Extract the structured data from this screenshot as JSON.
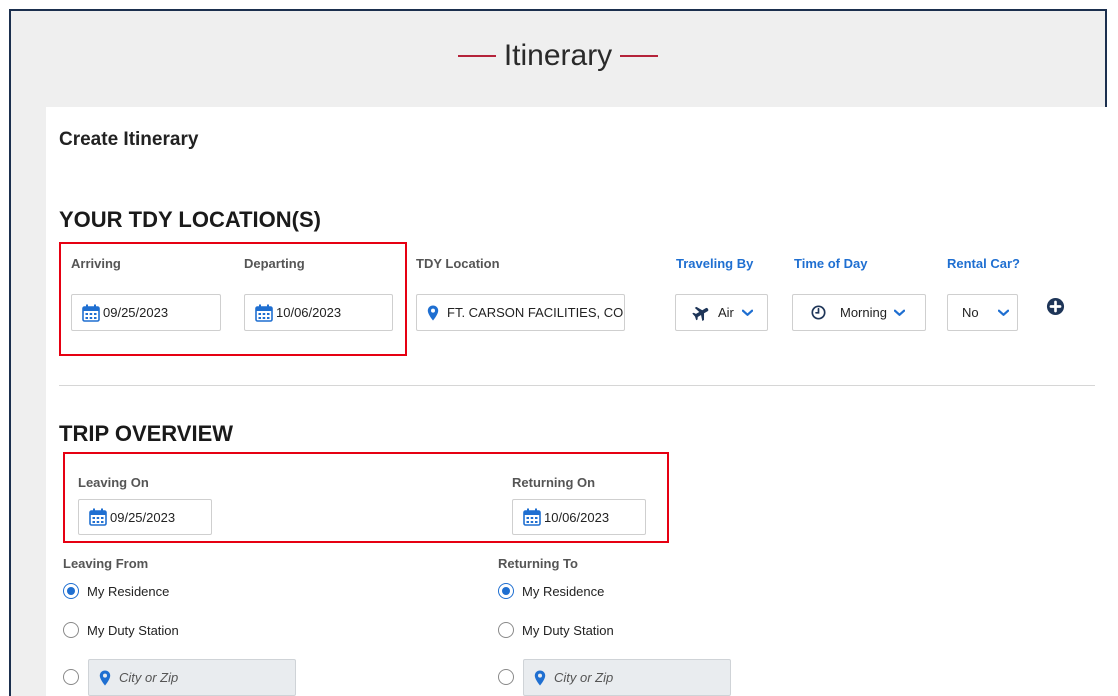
{
  "page": {
    "title": "Itinerary"
  },
  "card": {
    "title": "Create Itinerary"
  },
  "tdy": {
    "section_title": "YOUR TDY LOCATION(S)",
    "arriving_label": "Arriving",
    "arriving_value": "09/25/2023",
    "departing_label": "Departing",
    "departing_value": "10/06/2023",
    "location_label": "TDY Location",
    "location_value": "FT. CARSON FACILITIES, CO",
    "traveling_by_label": "Traveling By",
    "traveling_by_value": "Air",
    "time_of_day_label": "Time of Day",
    "time_of_day_value": "Morning",
    "rental_car_label": "Rental Car?",
    "rental_car_value": "No"
  },
  "trip": {
    "section_title": "TRIP OVERVIEW",
    "leaving_on_label": "Leaving On",
    "leaving_on_value": "09/25/2023",
    "returning_on_label": "Returning On",
    "returning_on_value": "10/06/2023",
    "leaving_from_label": "Leaving From",
    "returning_to_label": "Returning To",
    "options": {
      "residence": "My Residence",
      "duty_station": "My Duty Station",
      "city_placeholder": "City or Zip"
    }
  },
  "colors": {
    "accent": "#1f6fd1",
    "highlight": "#e60012",
    "title_rule": "#b5233a"
  }
}
